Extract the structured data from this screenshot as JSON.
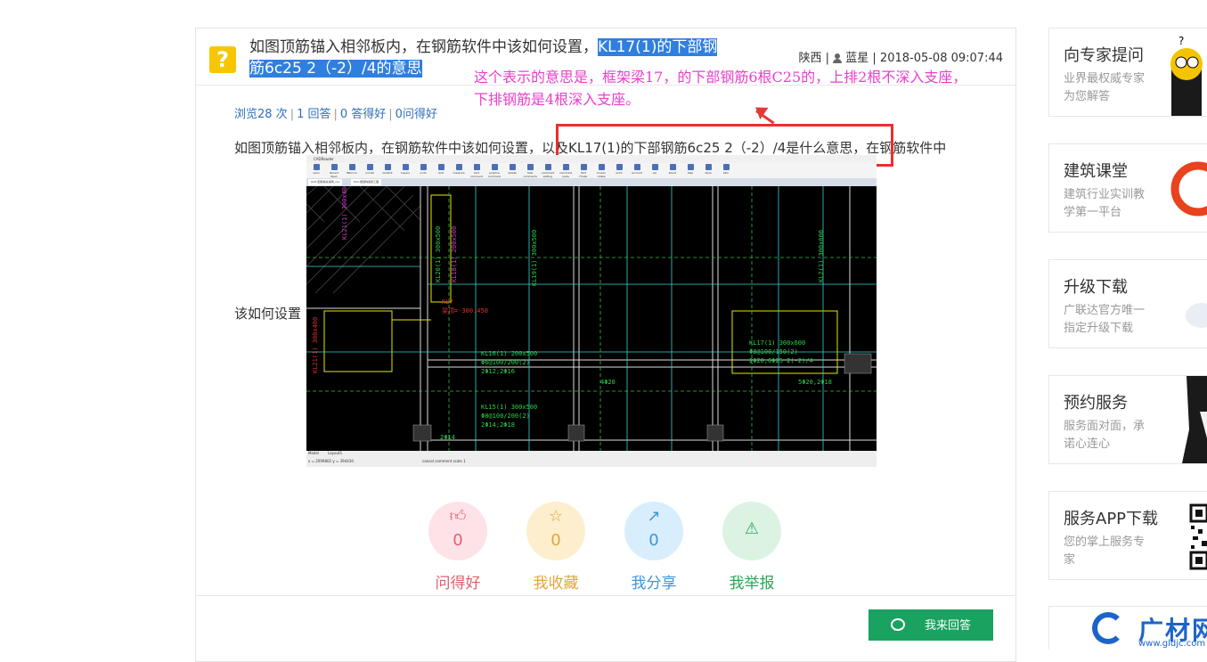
{
  "question": {
    "title_plain": "如图顶筋锚入相邻板内，在钢筋软件中该如何设置，",
    "title_highlight_1": "KL17(1)的下部钢",
    "title_highlight_2": "筋6c25 2（-2）/4的意思",
    "region": "陕西",
    "author": "蓝星",
    "date": "2018-05-08 09:07:44",
    "stats": {
      "views": "浏览28 次",
      "answers": "1 回答",
      "good_answers": "0 答得好",
      "good_questions": "0问得好"
    },
    "body_before_box": "如图顶筋锚入相邻板内，在钢筋软件中该如何设置，",
    "body_boxed": "以及KL17(1)的下部钢筋6c25 2（-2）/4是什么意思，",
    "body_after_box": "在钢筋软件中",
    "body_tail": "该如何设置"
  },
  "annotation": {
    "line1": "这个表示的意思是，框架梁17，的下部钢筋6根C25的，上排2根不深入支座，",
    "line2": "下排钢筋是4根深入支座。"
  },
  "cad": {
    "toolbar": [
      "open",
      "Recent Open",
      "BRIconl",
      "iconall",
      "zoolbrit",
      "Layers",
      "undo",
      "redo",
      "measure",
      "text comment",
      "polyline comment",
      "delete",
      "hide comments",
      "comment setting",
      "comment scale",
      "Text Finder",
      "screen rotate",
      "print",
      "account",
      "vip",
      "about",
      "help",
      "style",
      "Skin"
    ],
    "tabs": [
      "GGF-配筋梁总说明_xxx",
      "PCC-楼层构造施工图"
    ],
    "status_tabs": [
      "Model",
      "Layout1"
    ],
    "coords": "x = 2099802  y = 394430",
    "status_cmd": "cancel comment scale 1",
    "labels": {
      "kl16": "KL16(1) 200x500",
      "kl16_a": "Φ6@100/200(2)",
      "kl16_b": "2Φ12;2Φ16",
      "kl15": "KL15(1) 300x500",
      "kl15_a": "Φ8@100/200(2)",
      "kl15_b": "2Φ14;2Φ18",
      "kl17": "KL17(1) 300x600",
      "kl17_a": "Φ8@100/150(2)",
      "kl17_b": "2Φ20;6Φ25 2(-2)/4",
      "kl7": "KL7",
      "kl7_a": "梁顶=-300.450",
      "v1": "KL21(1) 300x400",
      "v2": "KL20(1) 300x500",
      "v3": "KL18(1) 200x500",
      "v4": "KL19(1) 300x500",
      "v5": "KL2(1) 300x600",
      "phi20": "4Φ20",
      "phi18": "5Φ20,2Φ18",
      "phi14": "2Φ14"
    }
  },
  "actions": [
    {
      "label": "问得好",
      "count": "0",
      "icon": "thumbs-up-icon",
      "bg": "#fde3e7",
      "fg": "#e0616f"
    },
    {
      "label": "我收藏",
      "count": "0",
      "icon": "star-icon",
      "bg": "#fdeecd",
      "fg": "#e3a53c"
    },
    {
      "label": "我分享",
      "count": "0",
      "icon": "share-icon",
      "bg": "#d8eefc",
      "fg": "#3d95d8"
    },
    {
      "label": "我举报",
      "count": "",
      "icon": "warning-icon",
      "bg": "#dcf3e3",
      "fg": "#2da55a"
    }
  ],
  "answer_button": "我来回答",
  "sidebar": [
    {
      "title": "向专家提问",
      "desc": "业界最权威专家为您解答"
    },
    {
      "title": "建筑课堂",
      "desc": "建筑行业实训教学第一平台"
    },
    {
      "title": "升级下载",
      "desc": "广联达官方唯一指定升级下载"
    },
    {
      "title": "预约服务",
      "desc": "服务面对面，承诺心连心"
    },
    {
      "title": "服务APP下载",
      "desc": "您的掌上服务专家"
    }
  ],
  "brand": {
    "text": "广材网",
    "url": "www.gldjc.com"
  }
}
